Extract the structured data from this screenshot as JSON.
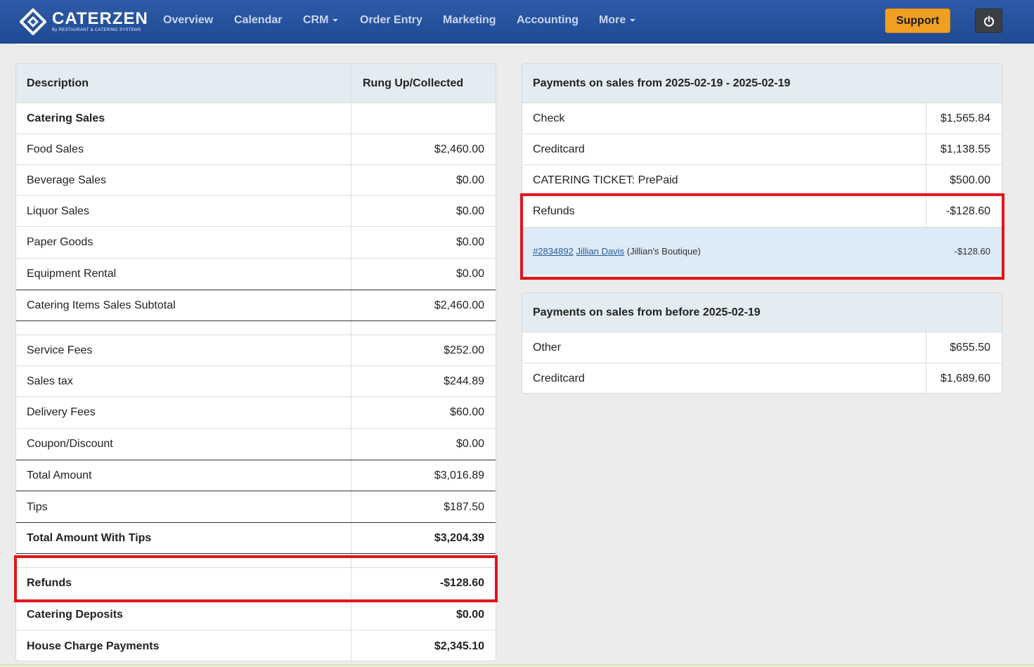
{
  "brand": {
    "name": "CATERZEN",
    "tagline": "By RESTAURANT & CATERING SYSTEMS"
  },
  "nav": {
    "items": [
      {
        "label": "Overview"
      },
      {
        "label": "Calendar"
      },
      {
        "label": "CRM"
      },
      {
        "label": "Order Entry"
      },
      {
        "label": "Marketing"
      },
      {
        "label": "Accounting"
      },
      {
        "label": "More"
      }
    ],
    "support_label": "Support"
  },
  "left_table": {
    "headers": {
      "description": "Description",
      "value": "Rung Up/Collected"
    },
    "rows": [
      {
        "desc": "Catering Sales",
        "value": ""
      },
      {
        "desc": "Food Sales",
        "value": "$2,460.00"
      },
      {
        "desc": "Beverage Sales",
        "value": "$0.00"
      },
      {
        "desc": "Liquor Sales",
        "value": "$0.00"
      },
      {
        "desc": "Paper Goods",
        "value": "$0.00"
      },
      {
        "desc": "Equipment Rental",
        "value": "$0.00"
      },
      {
        "desc": "Catering Items Sales Subtotal",
        "value": "$2,460.00"
      },
      {
        "desc": "Service Fees",
        "value": "$252.00"
      },
      {
        "desc": "Sales tax",
        "value": "$244.89"
      },
      {
        "desc": "Delivery Fees",
        "value": "$60.00"
      },
      {
        "desc": "Coupon/Discount",
        "value": "$0.00"
      },
      {
        "desc": "Total Amount",
        "value": "$3,016.89"
      },
      {
        "desc": "Tips",
        "value": "$187.50"
      },
      {
        "desc": "Total Amount With Tips",
        "value": "$3,204.39"
      },
      {
        "desc": "Refunds",
        "value": "-$128.60"
      },
      {
        "desc": "Catering Deposits",
        "value": "$0.00"
      },
      {
        "desc": "House Charge Payments",
        "value": "$2,345.10"
      }
    ]
  },
  "payments_current": {
    "title": "Payments on sales from 2025-02-19 - 2025-02-19",
    "rows": [
      {
        "desc": "Check",
        "value": "$1,565.84"
      },
      {
        "desc": "Creditcard",
        "value": "$1,138.55"
      },
      {
        "desc": "CATERING TICKET: PrePaid",
        "value": "$500.00"
      },
      {
        "desc": "Refunds",
        "value": "-$128.60"
      }
    ],
    "refund_detail": {
      "order_link": "#2834892",
      "customer_link": "Jillian Davis",
      "company": "(Jillian's Boutique)",
      "amount": "-$128.60"
    }
  },
  "payments_before": {
    "title": "Payments on sales from before 2025-02-19",
    "rows": [
      {
        "desc": "Other",
        "value": "$655.50"
      },
      {
        "desc": "Creditcard",
        "value": "$1,689.60"
      }
    ]
  },
  "colors": {
    "nav": "#1f4a94",
    "support": "#f0a020",
    "highlight": "#e0161c",
    "header": "#e4ecf1"
  }
}
